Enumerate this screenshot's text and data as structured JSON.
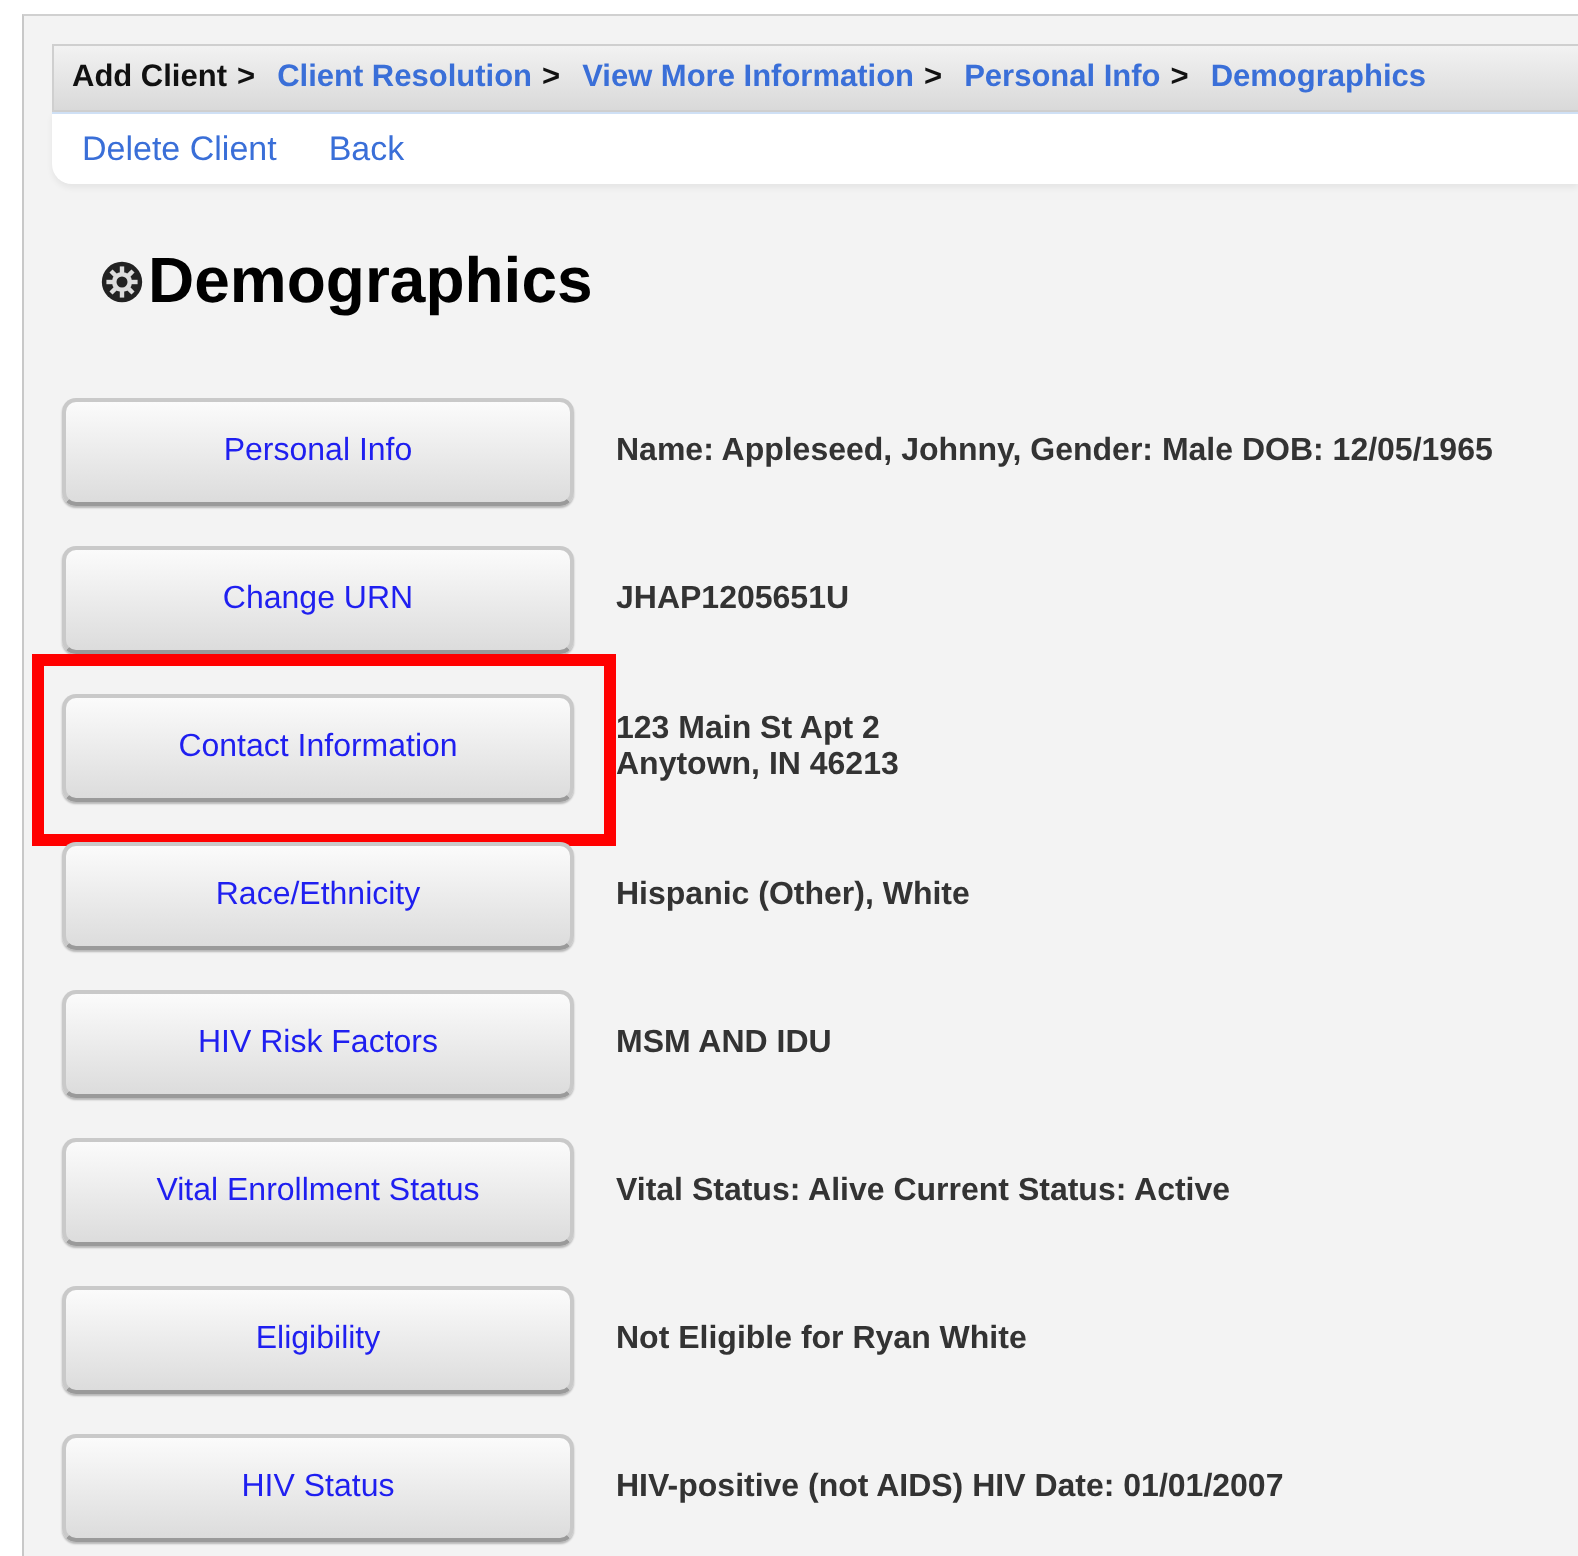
{
  "breadcrumb": [
    {
      "label": "Add Client",
      "link": false,
      "separator": ">"
    },
    {
      "label": "Client Resolution",
      "link": true,
      "separator": ">"
    },
    {
      "label": "View More Information",
      "link": true,
      "separator": ">"
    },
    {
      "label": "Personal Info",
      "link": true,
      "separator": ">"
    },
    {
      "label": "Demographics",
      "link": true
    }
  ],
  "actions": [
    "Delete Client",
    "Back"
  ],
  "heading": "Demographics",
  "sections": [
    {
      "button": "Personal Info",
      "details": [
        "Name: Appleseed, Johnny, Gender: Male DOB: 12/05/1965"
      ],
      "highlighted": false
    },
    {
      "button": "Change URN",
      "details": [
        "JHAP1205651U"
      ],
      "highlighted": false
    },
    {
      "button": "Contact Information",
      "details": [
        "123 Main St Apt 2",
        "Anytown, IN 46213"
      ],
      "highlighted": true
    },
    {
      "button": "Race/Ethnicity",
      "details": [
        "Hispanic (Other), White"
      ],
      "highlighted": false
    },
    {
      "button": "HIV Risk Factors",
      "details": [
        "MSM AND IDU"
      ],
      "highlighted": false
    },
    {
      "button": "Vital Enrollment Status",
      "details": [
        "Vital Status: Alive Current Status: Active"
      ],
      "highlighted": false
    },
    {
      "button": "Eligibility",
      "details": [
        "Not Eligible for Ryan White"
      ],
      "highlighted": false
    },
    {
      "button": "HIV Status",
      "details": [
        "HIV-positive (not AIDS) HIV Date: 01/01/2007"
      ],
      "highlighted": false
    }
  ]
}
